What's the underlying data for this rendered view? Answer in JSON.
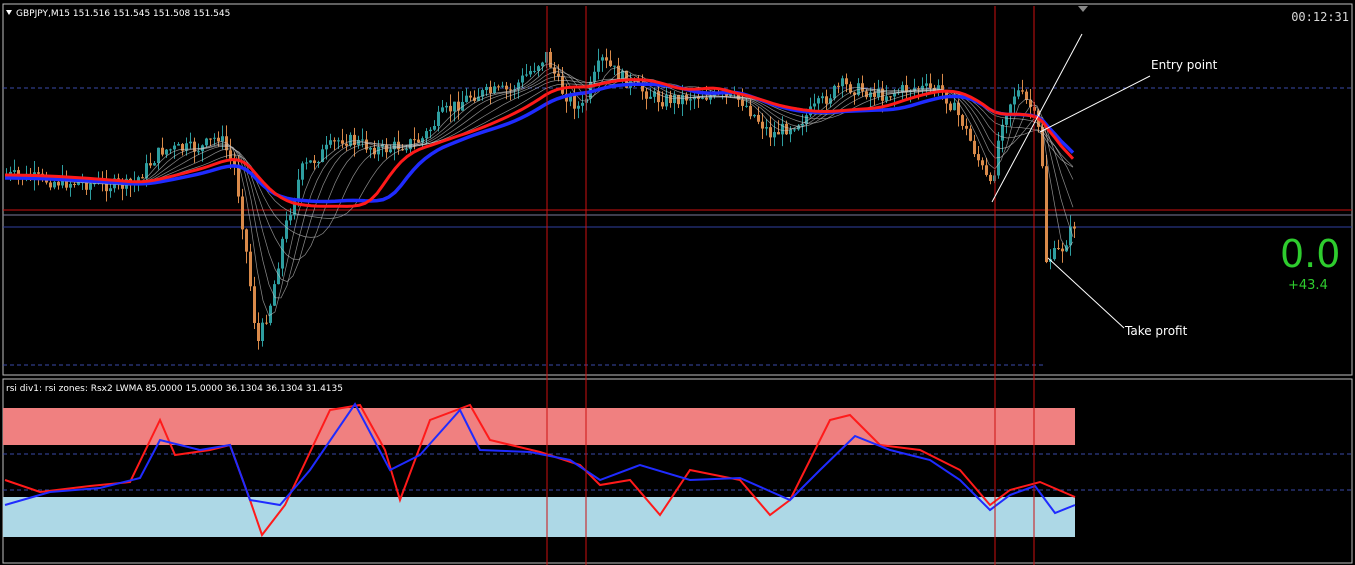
{
  "header": {
    "collapse_icon": "triangle-down-icon",
    "symbol_line": "GBPJPY,M15  151.516 151.545 151.508 151.545",
    "clock": "00:12:31"
  },
  "indicator": {
    "title": "rsi div1: rsi zones: Rsx2 LWMA 85.0000 15.0000 36.1304 36.1304 31.4135"
  },
  "profit_panel": {
    "value": "0.0",
    "delta": "+43.4"
  },
  "annotations": {
    "entry": "Entry point",
    "take_profit": "Take profit"
  },
  "colors": {
    "background": "#000000",
    "bull_candle": "#2e9ea0",
    "bear_candle": "#d98a4a",
    "ma_red": "#ff1a1a",
    "ma_blue": "#1f2bff",
    "vertical_marker": "#cc1111",
    "overbought_zone": "#f08080",
    "oversold_zone": "#add8e6",
    "profit_green": "#2ecc2e"
  },
  "chart_data": [
    {
      "type": "candlestick",
      "symbol": "GBPJPY",
      "timeframe": "M15",
      "ohlc_last": {
        "open": 151.516,
        "high": 151.545,
        "low": 151.508,
        "close": 151.545
      },
      "grid": false,
      "overlays": [
        "moving-average ribbon",
        "fast MA (red)",
        "slow MA (blue)",
        "horizontal levels",
        "entry / take-profit trend lines"
      ]
    },
    {
      "type": "line",
      "indicator": "Rsx2 LWMA",
      "levels": {
        "overbought": 85.0,
        "oversold": 15.0
      },
      "values": [
        36.1304,
        36.1304,
        31.4135
      ],
      "series_colors": [
        "#ff1a1a",
        "#1f2bff"
      ]
    }
  ]
}
